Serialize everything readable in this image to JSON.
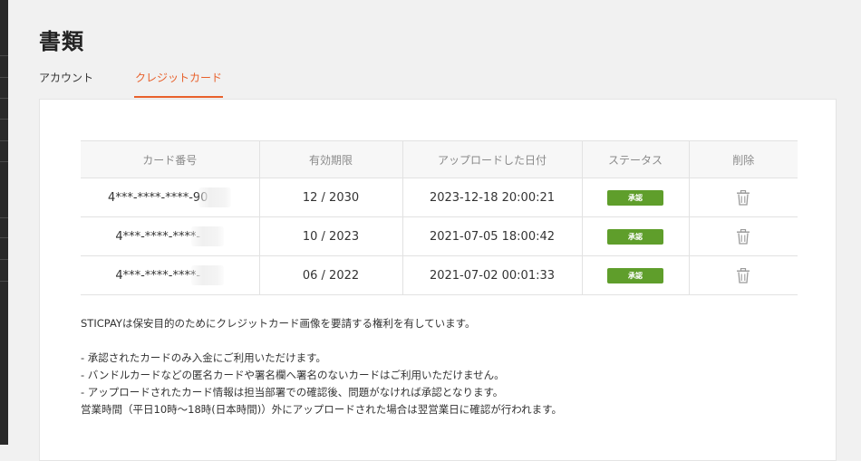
{
  "page": {
    "title": "書類"
  },
  "tabs": [
    {
      "label": "アカウント",
      "active": false
    },
    {
      "label": "クレジットカード",
      "active": true
    }
  ],
  "table": {
    "headers": [
      "カード番号",
      "有効期限",
      "アップロードした日付",
      "ステータス",
      "削除"
    ],
    "rows": [
      {
        "card_number": "4***-****-****-90",
        "expiry": "12 / 2030",
        "uploaded": "2023-12-18 20:00:21",
        "status": "承認",
        "delete_icon": "trash-icon"
      },
      {
        "card_number": "4***-****-****-",
        "expiry": "10 / 2023",
        "uploaded": "2021-07-05 18:00:42",
        "status": "承認",
        "delete_icon": "trash-icon"
      },
      {
        "card_number": "4***-****-****-",
        "expiry": "06 / 2022",
        "uploaded": "2021-07-02 00:01:33",
        "status": "承認",
        "delete_icon": "trash-icon"
      }
    ]
  },
  "notes": {
    "intro": "STICPAYは保安目的のためにクレジットカード画像を要請する権利を有しています。",
    "lines": [
      "- 承認されたカードのみ入金にご利用いただけます。",
      "- バンドルカードなどの匿名カードや署名欄へ署名のないカードはご利用いただけません。",
      "- アップロードされたカード情報は担当部署での確認後、問題がなければ承認となります。",
      "営業時間（平日10時～18時(日本時間)）外にアップロードされた場合は翌営業日に確認が行われます。"
    ]
  },
  "colors": {
    "accent": "#e8612c",
    "status_approved": "#5f9e2b",
    "page_background": "#f1f1f1",
    "panel_background": "#ffffff"
  }
}
